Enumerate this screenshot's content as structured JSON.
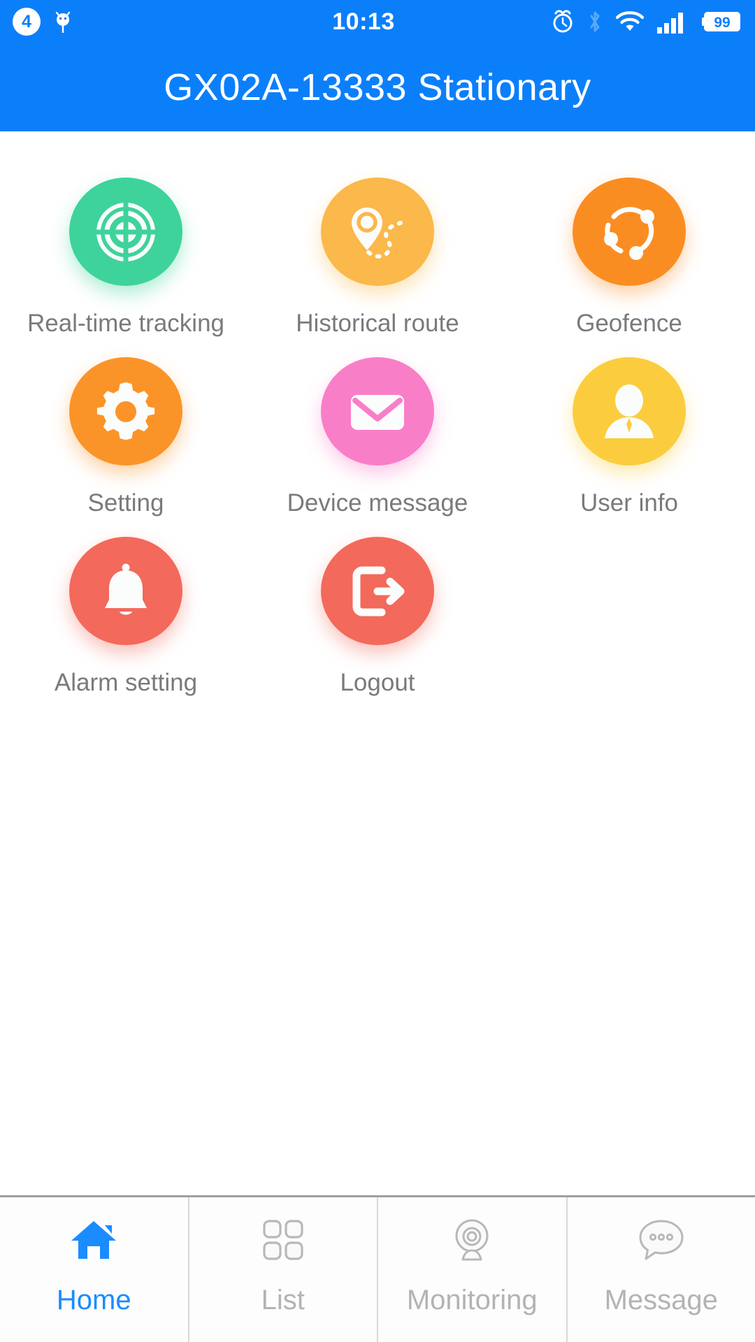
{
  "status_bar": {
    "notification_count": "4",
    "debug_icon": "android-debug-icon",
    "time": "10:13",
    "icons": [
      {
        "name": "alarm-clock-icon"
      },
      {
        "name": "bluetooth-icon"
      },
      {
        "name": "wifi-icon"
      },
      {
        "name": "cellular-signal-icon"
      },
      {
        "name": "battery-icon"
      }
    ],
    "battery_level": "99",
    "background_color": "#0b7ffa",
    "foreground_color": "#ffffff"
  },
  "app_bar": {
    "title": "GX02A-13333 Stationary",
    "background_color": "#0b7ffa",
    "title_color": "#ffffff"
  },
  "menu": {
    "items": [
      {
        "label": "Real-time tracking",
        "icon": "radar-target-icon",
        "color": "#3ed39b"
      },
      {
        "label": "Historical route",
        "icon": "map-pin-route-icon",
        "color": "#fbb84b"
      },
      {
        "label": "Geofence",
        "icon": "geofence-share-icon",
        "color": "#fa8d22"
      },
      {
        "label": "Setting",
        "icon": "gear-icon",
        "color": "#fb9428"
      },
      {
        "label": "Device message",
        "icon": "envelope-icon",
        "color": "#f97ec8"
      },
      {
        "label": "User info",
        "icon": "user-silhouette-icon",
        "color": "#fbcd3e"
      },
      {
        "label": "Alarm setting",
        "icon": "bell-icon",
        "color": "#f3695b"
      },
      {
        "label": "Logout",
        "icon": "logout-arrow-icon",
        "color": "#f3695b"
      }
    ],
    "label_color": "#7a7a7a"
  },
  "bottom_nav": {
    "active_color": "#1a8cff",
    "inactive_color": "#b3b3b3",
    "items": [
      {
        "label": "Home",
        "icon": "home-icon",
        "active": true
      },
      {
        "label": "List",
        "icon": "grid-squares-icon",
        "active": false
      },
      {
        "label": "Monitoring",
        "icon": "webcam-icon",
        "active": false
      },
      {
        "label": "Message",
        "icon": "chat-bubble-icon",
        "active": false
      }
    ]
  }
}
